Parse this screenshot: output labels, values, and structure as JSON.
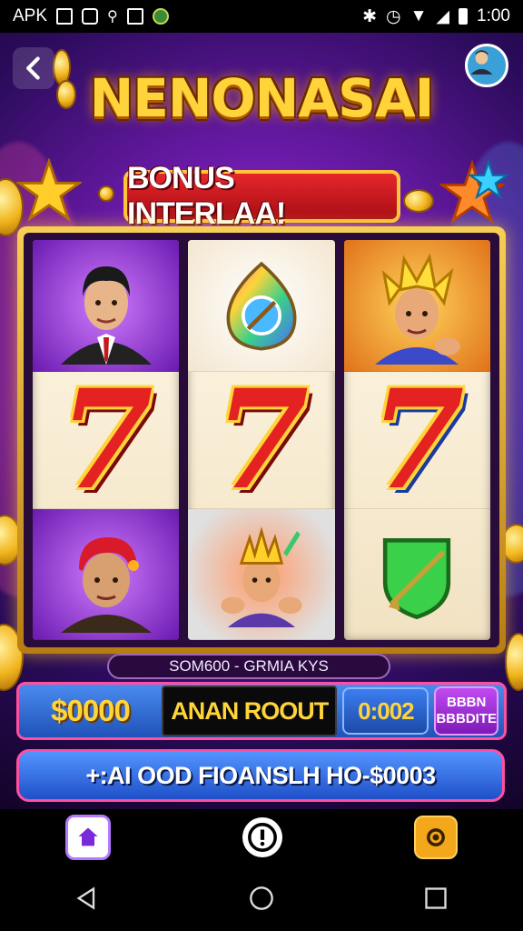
{
  "status_bar": {
    "app_label": "APK",
    "time": "1:00"
  },
  "header": {
    "title": "NENONASAI",
    "bonus_label": "BONUS INTERLAA!",
    "back_icon": "chevron-left-icon",
    "avatar_icon": "player-avatar"
  },
  "reels": [
    {
      "symbols": [
        "businessman-portrait",
        "seven",
        "bandana-boy-portrait"
      ]
    },
    {
      "symbols": [
        "rainbow-gem",
        "seven",
        "warrior-character"
      ]
    },
    {
      "symbols": [
        "spiky-hair-hero",
        "seven",
        "green-shield-sword"
      ]
    }
  ],
  "seven_label": "7",
  "info_bar": {
    "text": "SOM600 - GRMIA KYS"
  },
  "controls": {
    "balance": "$0000",
    "win_display": "ANAN ROOUT",
    "timer": "0:002",
    "side_button_line1": "BBBN",
    "side_button_line2": "BBBDITE"
  },
  "ticker": {
    "text": "+:AI OOD FIOANSLH HO-$0003"
  },
  "bottom_nav": [
    "home-icon",
    "info-icon",
    "settings-icon"
  ],
  "system_nav": [
    "back-icon",
    "home-circle-icon",
    "recents-icon"
  ],
  "colors": {
    "accent_gold": "#ffd43a",
    "accent_red": "#e52222",
    "panel_blue": "#2052b8",
    "border_pink": "#ff4fa0",
    "background_purple": "#6a1aa8"
  }
}
